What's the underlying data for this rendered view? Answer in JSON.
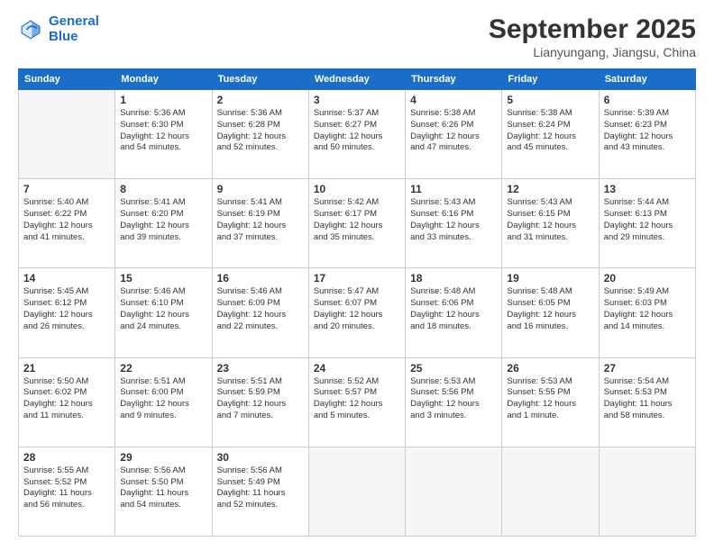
{
  "header": {
    "logo_line1": "General",
    "logo_line2": "Blue",
    "month": "September 2025",
    "location": "Lianyungang, Jiangsu, China"
  },
  "days_of_week": [
    "Sunday",
    "Monday",
    "Tuesday",
    "Wednesday",
    "Thursday",
    "Friday",
    "Saturday"
  ],
  "weeks": [
    [
      {
        "day": "",
        "info": ""
      },
      {
        "day": "1",
        "info": "Sunrise: 5:36 AM\nSunset: 6:30 PM\nDaylight: 12 hours\nand 54 minutes."
      },
      {
        "day": "2",
        "info": "Sunrise: 5:36 AM\nSunset: 6:28 PM\nDaylight: 12 hours\nand 52 minutes."
      },
      {
        "day": "3",
        "info": "Sunrise: 5:37 AM\nSunset: 6:27 PM\nDaylight: 12 hours\nand 50 minutes."
      },
      {
        "day": "4",
        "info": "Sunrise: 5:38 AM\nSunset: 6:26 PM\nDaylight: 12 hours\nand 47 minutes."
      },
      {
        "day": "5",
        "info": "Sunrise: 5:38 AM\nSunset: 6:24 PM\nDaylight: 12 hours\nand 45 minutes."
      },
      {
        "day": "6",
        "info": "Sunrise: 5:39 AM\nSunset: 6:23 PM\nDaylight: 12 hours\nand 43 minutes."
      }
    ],
    [
      {
        "day": "7",
        "info": "Sunrise: 5:40 AM\nSunset: 6:22 PM\nDaylight: 12 hours\nand 41 minutes."
      },
      {
        "day": "8",
        "info": "Sunrise: 5:41 AM\nSunset: 6:20 PM\nDaylight: 12 hours\nand 39 minutes."
      },
      {
        "day": "9",
        "info": "Sunrise: 5:41 AM\nSunset: 6:19 PM\nDaylight: 12 hours\nand 37 minutes."
      },
      {
        "day": "10",
        "info": "Sunrise: 5:42 AM\nSunset: 6:17 PM\nDaylight: 12 hours\nand 35 minutes."
      },
      {
        "day": "11",
        "info": "Sunrise: 5:43 AM\nSunset: 6:16 PM\nDaylight: 12 hours\nand 33 minutes."
      },
      {
        "day": "12",
        "info": "Sunrise: 5:43 AM\nSunset: 6:15 PM\nDaylight: 12 hours\nand 31 minutes."
      },
      {
        "day": "13",
        "info": "Sunrise: 5:44 AM\nSunset: 6:13 PM\nDaylight: 12 hours\nand 29 minutes."
      }
    ],
    [
      {
        "day": "14",
        "info": "Sunrise: 5:45 AM\nSunset: 6:12 PM\nDaylight: 12 hours\nand 26 minutes."
      },
      {
        "day": "15",
        "info": "Sunrise: 5:46 AM\nSunset: 6:10 PM\nDaylight: 12 hours\nand 24 minutes."
      },
      {
        "day": "16",
        "info": "Sunrise: 5:46 AM\nSunset: 6:09 PM\nDaylight: 12 hours\nand 22 minutes."
      },
      {
        "day": "17",
        "info": "Sunrise: 5:47 AM\nSunset: 6:07 PM\nDaylight: 12 hours\nand 20 minutes."
      },
      {
        "day": "18",
        "info": "Sunrise: 5:48 AM\nSunset: 6:06 PM\nDaylight: 12 hours\nand 18 minutes."
      },
      {
        "day": "19",
        "info": "Sunrise: 5:48 AM\nSunset: 6:05 PM\nDaylight: 12 hours\nand 16 minutes."
      },
      {
        "day": "20",
        "info": "Sunrise: 5:49 AM\nSunset: 6:03 PM\nDaylight: 12 hours\nand 14 minutes."
      }
    ],
    [
      {
        "day": "21",
        "info": "Sunrise: 5:50 AM\nSunset: 6:02 PM\nDaylight: 12 hours\nand 11 minutes."
      },
      {
        "day": "22",
        "info": "Sunrise: 5:51 AM\nSunset: 6:00 PM\nDaylight: 12 hours\nand 9 minutes."
      },
      {
        "day": "23",
        "info": "Sunrise: 5:51 AM\nSunset: 5:59 PM\nDaylight: 12 hours\nand 7 minutes."
      },
      {
        "day": "24",
        "info": "Sunrise: 5:52 AM\nSunset: 5:57 PM\nDaylight: 12 hours\nand 5 minutes."
      },
      {
        "day": "25",
        "info": "Sunrise: 5:53 AM\nSunset: 5:56 PM\nDaylight: 12 hours\nand 3 minutes."
      },
      {
        "day": "26",
        "info": "Sunrise: 5:53 AM\nSunset: 5:55 PM\nDaylight: 12 hours\nand 1 minute."
      },
      {
        "day": "27",
        "info": "Sunrise: 5:54 AM\nSunset: 5:53 PM\nDaylight: 11 hours\nand 58 minutes."
      }
    ],
    [
      {
        "day": "28",
        "info": "Sunrise: 5:55 AM\nSunset: 5:52 PM\nDaylight: 11 hours\nand 56 minutes."
      },
      {
        "day": "29",
        "info": "Sunrise: 5:56 AM\nSunset: 5:50 PM\nDaylight: 11 hours\nand 54 minutes."
      },
      {
        "day": "30",
        "info": "Sunrise: 5:56 AM\nSunset: 5:49 PM\nDaylight: 11 hours\nand 52 minutes."
      },
      {
        "day": "",
        "info": ""
      },
      {
        "day": "",
        "info": ""
      },
      {
        "day": "",
        "info": ""
      },
      {
        "day": "",
        "info": ""
      }
    ]
  ]
}
